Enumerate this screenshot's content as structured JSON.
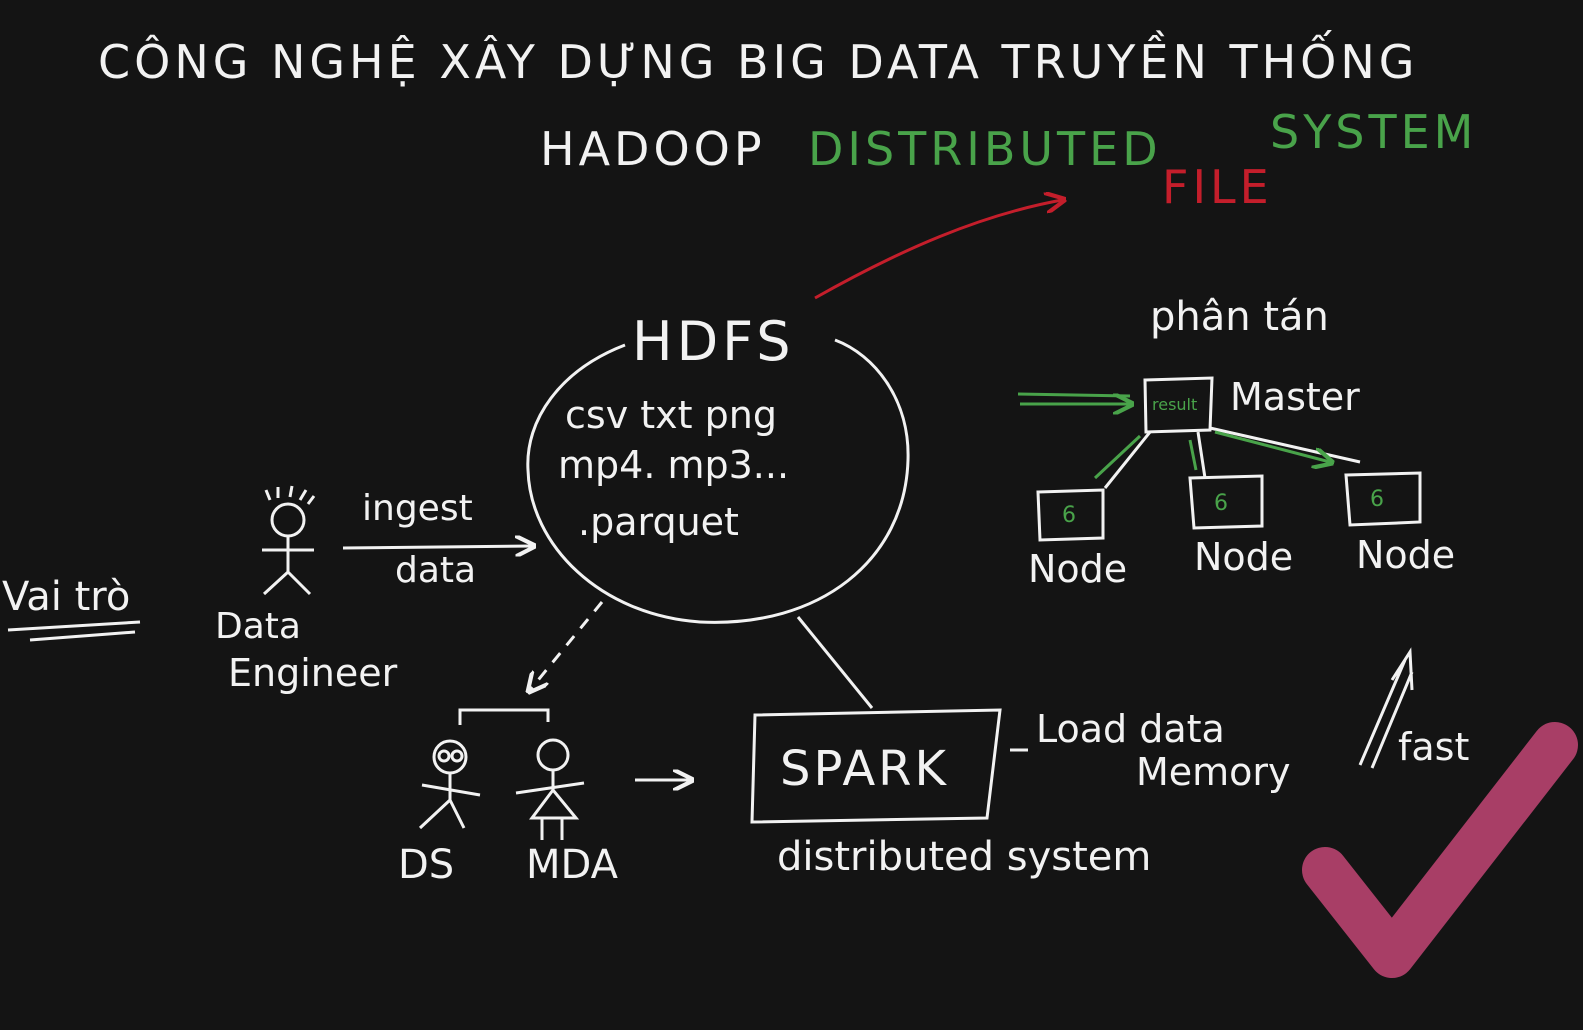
{
  "colors": {
    "background": "#141414",
    "chalk": "#f2f2f2",
    "green": "#49a34a",
    "red": "#c41e2b",
    "check": "#b8436f"
  },
  "title": {
    "line1": "CÔNG NGHỆ XÂY DỰNG BIG DATA TRUYỀN THỐNG",
    "hadoop": "HADOOP",
    "distributed": "DISTRIBUTED",
    "system": "SYSTEM",
    "file": "FILE"
  },
  "hdfs": {
    "label": "HDFS",
    "formats_line1": "csv txt png",
    "formats_line2": "mp4. mp3...",
    "formats_line3": ".parquet"
  },
  "roles": {
    "label": "Vai trò",
    "data_engineer_line1": "Data",
    "data_engineer_line2": "Engineer",
    "ingest_line1": "ingest",
    "ingest_line2": "data",
    "ds": "DS",
    "mda": "MDA"
  },
  "spark": {
    "label": "SPARK",
    "caption": "distributed system",
    "load_line1": "Load data",
    "load_line2": "Memory",
    "fast": "fast"
  },
  "cluster": {
    "heading": "phân tán",
    "master": "Master",
    "result": "result",
    "nodes": [
      {
        "label": "Node",
        "value": "6"
      },
      {
        "label": "Node",
        "value": "6"
      },
      {
        "label": "Node",
        "value": "6"
      }
    ]
  },
  "icons": [
    "stick-figure-icon",
    "arrow-icon",
    "checkmark-icon"
  ]
}
